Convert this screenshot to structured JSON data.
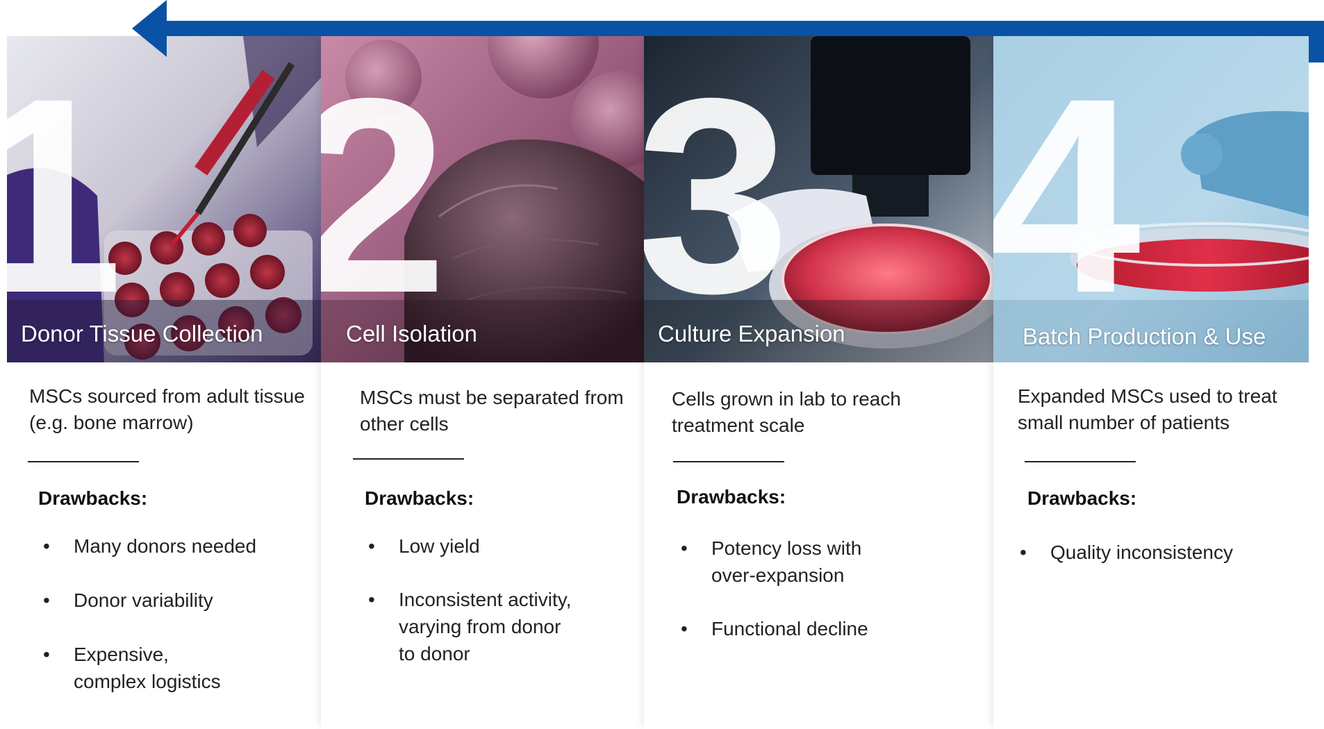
{
  "colors": {
    "arrow": "#0a52a6",
    "text": "#222222",
    "heading": "#111111",
    "numeral": "#ffffff"
  },
  "icons": {
    "flow": "arrow-left-icon",
    "bullet": "bullet-dot-icon"
  },
  "steps": [
    {
      "number": "1",
      "title": "Donor Tissue Collection",
      "description": "MSCs sourced from adult tissue (e.g. bone marrow)",
      "drawbacks_heading": "Drawbacks:",
      "drawbacks": [
        "Many donors needed",
        "Donor variability",
        "Expensive, complex logistics"
      ]
    },
    {
      "number": "2",
      "title": "Cell Isolation",
      "description": "MSCs must be separated from other cells",
      "drawbacks_heading": "Drawbacks:",
      "drawbacks": [
        "Low yield",
        "Inconsistent activity, varying from donor to donor"
      ]
    },
    {
      "number": "3",
      "title": "Culture Expansion",
      "description": "Cells grown in lab to reach treatment scale",
      "drawbacks_heading": "Drawbacks:",
      "drawbacks": [
        "Potency loss with over-expansion",
        "Functional decline"
      ]
    },
    {
      "number": "4",
      "title": "Batch Production & Use",
      "description": "Expanded MSCs used to treat small number of patients",
      "drawbacks_heading": "Drawbacks:",
      "drawbacks": [
        "Quality inconsistency"
      ]
    }
  ]
}
